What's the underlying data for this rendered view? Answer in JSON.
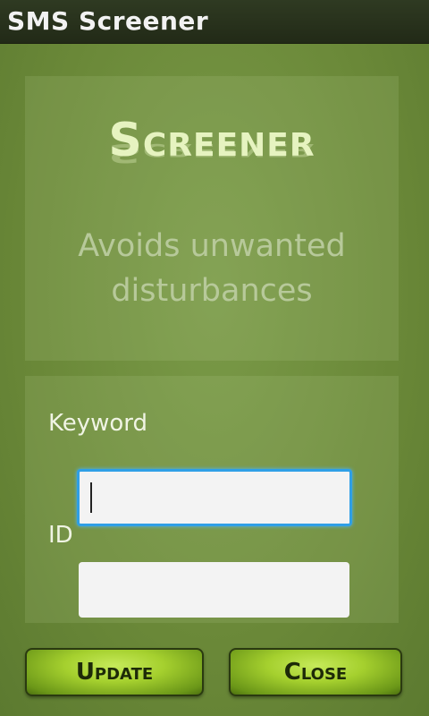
{
  "app": {
    "title": "SMS Screener"
  },
  "banner": {
    "logo_text": "Screener",
    "tagline_line1": "Avoids unwanted",
    "tagline_line2": "disturbances"
  },
  "form": {
    "keyword_label": "Keyword",
    "keyword_value": "",
    "id_label": "ID",
    "id_value": ""
  },
  "buttons": {
    "update_label": "Update",
    "close_label": "Close"
  },
  "colors": {
    "background": "#6e8c3c",
    "titlebar": "#222a17",
    "accent_focus": "#2f9fe6",
    "button": "#a5d02e"
  }
}
